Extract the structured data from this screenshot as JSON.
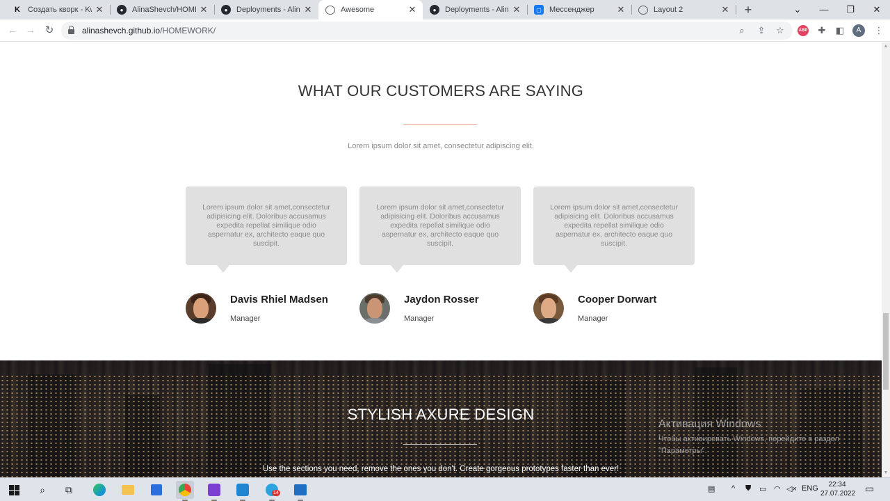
{
  "browser": {
    "tabs": [
      {
        "title": "Создать кворк - Kwork",
        "favicon": "kwork-icon",
        "active": false
      },
      {
        "title": "AlinaShevch/HOMEWORK",
        "favicon": "github-icon",
        "active": false
      },
      {
        "title": "Deployments - AlinaShevch",
        "favicon": "github-icon",
        "active": false
      },
      {
        "title": "Awesome",
        "favicon": "globe-icon",
        "active": true
      },
      {
        "title": "Deployments - AlinaShevch",
        "favicon": "github-icon",
        "active": false
      },
      {
        "title": "Мессенджер",
        "favicon": "messenger-icon",
        "active": false
      },
      {
        "title": "Layout 2",
        "favicon": "globe-icon",
        "active": false
      }
    ],
    "url_host": "alinashevch.github.io",
    "url_path": "/HOMEWORK/",
    "profile_initial": "A",
    "abp_label": "ABP"
  },
  "page": {
    "testimonials": {
      "title": "WHAT OUR CUSTOMERS ARE SAYING",
      "subtitle": "Lorem ipsum dolor sit amet, consectetur adipiscing elit.",
      "items": [
        {
          "quote": "Lorem ipsum dolor sit amet,consectetur adipisicing elit. Doloribus accusamus expedita repellat similique odio aspernatur ex, architecto eaque quo suscipit.",
          "name": "Davis Rhiel Madsen",
          "role": "Manager"
        },
        {
          "quote": "Lorem ipsum dolor sit amet,consectetur adipisicing elit. Doloribus accusamus expedita repellat similique odio aspernatur ex, architecto eaque quo suscipit.",
          "name": "Jaydon Rosser",
          "role": "Manager"
        },
        {
          "quote": "Lorem ipsum dolor sit amet,consectetur adipisicing elit. Doloribus accusamus expedita repellat similique odio aspernatur ex, architecto eaque quo suscipit.",
          "name": "Cooper Dorwart",
          "role": "Manager"
        }
      ]
    },
    "banner": {
      "title": "STYLISH AXURE DESIGN",
      "subtitle": "Use the sections you need, remove the ones you don't. Create gorgeous prototypes faster than ever!"
    }
  },
  "windows_activation": {
    "title": "Активация Windows",
    "text": "Чтобы активировать Windows, перейдите в раздел \"Параметры\"."
  },
  "taskbar": {
    "telegram_badge": "14",
    "language": "ENG",
    "time": "22:34",
    "date": "27.07.2022"
  }
}
